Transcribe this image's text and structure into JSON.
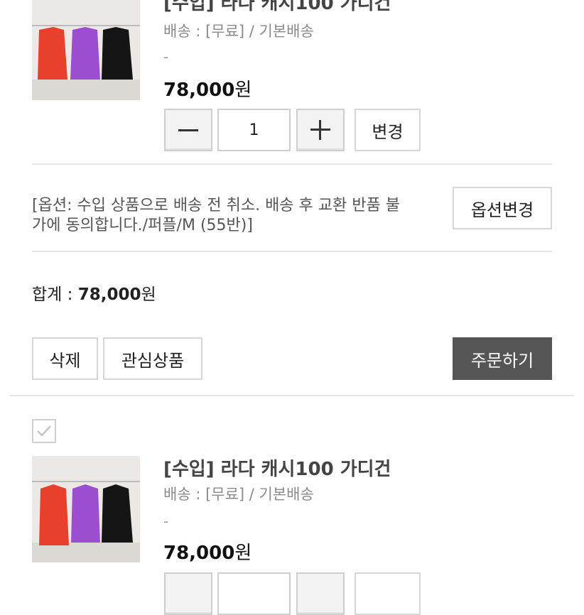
{
  "items": [
    {
      "title": "[수입] 라다 캐시100 가디건",
      "shipping": "배송 : [무료] / 기본배송",
      "dash": "-",
      "price_num": "78,000",
      "price_unit": "원",
      "qty": "1",
      "change_label": "변경"
    },
    {
      "title": "[수입] 라다 캐시100 가디건",
      "shipping": "배송 : [무료] / 기본배송",
      "dash": "-",
      "price_num": "78,000",
      "price_unit": "원"
    }
  ],
  "option": {
    "text": "[옵션: 수입 상품으로 배송 전 취소. 배송 후 교환 반품 불가에 동의합니다./퍼플/M (55반)]",
    "change_label": "옵션변경"
  },
  "total": {
    "label": "합계 : ",
    "value": "78,000",
    "unit": "원"
  },
  "actions": {
    "delete_label": "삭제",
    "wishlist_label": "관심상품",
    "order_label": "주문하기"
  },
  "colors": {
    "order_button": "#555555",
    "cardigans": [
      "#e8402d",
      "#9b4fd0",
      "#151515"
    ]
  }
}
